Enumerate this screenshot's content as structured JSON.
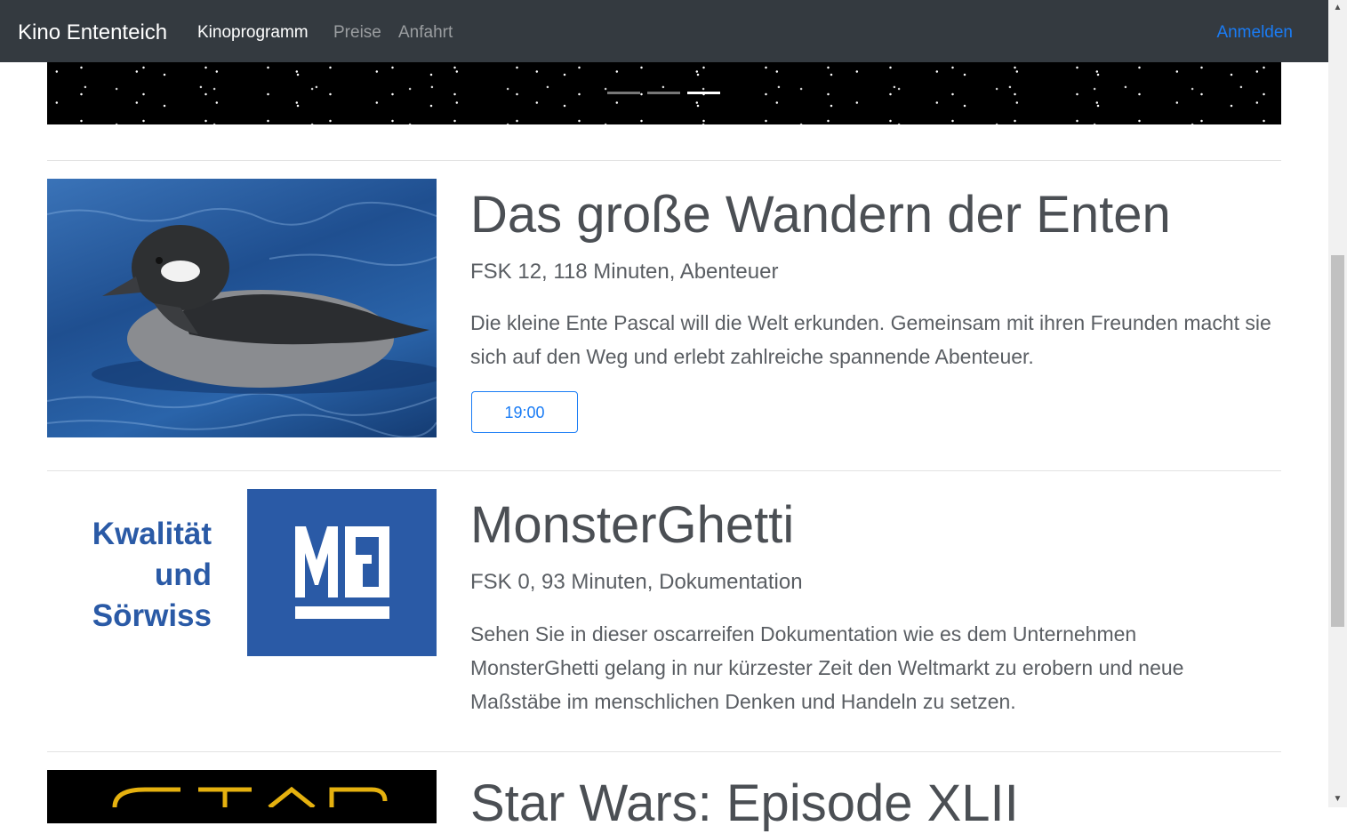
{
  "navbar": {
    "brand": "Kino Ententeich",
    "links": [
      {
        "label": "Kinoprogramm",
        "active": true
      },
      {
        "label": "Preise",
        "active": false
      },
      {
        "label": "Anfahrt",
        "active": false
      }
    ],
    "login": "Anmelden"
  },
  "carousel": {
    "indicators": [
      {
        "active": false
      },
      {
        "active": false
      },
      {
        "active": true
      }
    ]
  },
  "movies": [
    {
      "title": "Das große Wandern der Enten",
      "meta": "FSK 12, 118 Minuten, Abenteuer",
      "description": "Die kleine Ente Pascal will die Welt erkunden. Gemeinsam mit ihren Freunden macht sie sich auf den Weg und erlebt zahlreiche spannende Abenteuer.",
      "showtimes": [
        "19:00"
      ],
      "image": "duck-photo"
    },
    {
      "title": "MonsterGhetti",
      "meta": "FSK 0, 93 Minuten, Dokumentation",
      "description": "Sehen Sie in dieser oscarreifen Dokumentation wie es dem Unternehmen MonsterGhetti gelang in nur kürzester Zeit den Weltmarkt zu erobern und neue Maßstäbe im menschlichen Denken und Handeln zu setzen.",
      "image": "monsterghetti-logo",
      "logo_text": [
        "Kwalität",
        "und",
        "Sörwiss"
      ]
    },
    {
      "title": "Star Wars: Episode XLII",
      "image": "star-wars-poster"
    }
  ],
  "colors": {
    "navbar_bg": "#343a40",
    "accent": "#1a7cf5",
    "logo_blue": "#2a5aa6"
  }
}
